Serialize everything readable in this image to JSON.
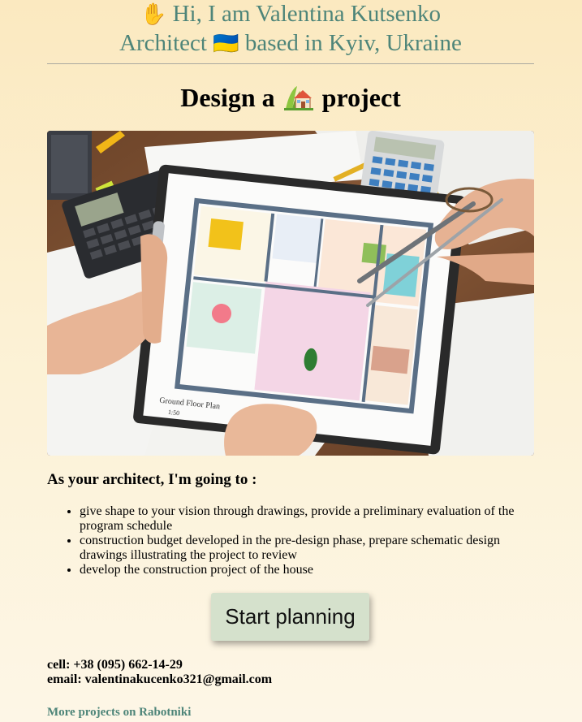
{
  "intro": {
    "wave_emoji": "✋",
    "line1_text": "Hi, I am Valentina Kutsenko",
    "line2_prefix": "Architect",
    "flag_emoji": "🇺🇦",
    "line2_suffix": "based in Kyiv, Ukraine"
  },
  "headline": {
    "before": "Design a",
    "after": "project",
    "icon": "house-with-garden-icon"
  },
  "photo": {
    "subject": "floor-plan-photo",
    "plan_caption": "Ground Floor Plan",
    "plan_scale": "1:50"
  },
  "section": {
    "heading": "As your architect, I'm going to :",
    "items": [
      "give shape to your vision through drawings, provide a preliminary evaluation of the program schedule",
      "construction budget developed in the pre-design phase, prepare schematic design drawings illustrating the project to review",
      "develop the construction project of the house"
    ]
  },
  "cta": {
    "label": "Start planning"
  },
  "contacts": {
    "cell": "cell: +38 (095) 662-14-29",
    "email": "email: valentinakucenko321@gmail.com"
  },
  "footer": {
    "link_text": "More projects on Rabotniki"
  },
  "colors": {
    "accent_teal": "#4e8579",
    "button_bg": "#d5e1cc",
    "bg_top": "#fbe9c0",
    "bg_bottom": "#fdf6e6"
  }
}
